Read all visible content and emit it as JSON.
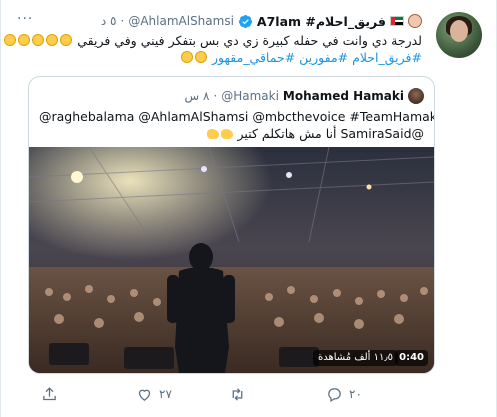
{
  "tweet": {
    "display_name": "A7lam #فريق_احلام",
    "handle": "@AhlamAlShamsi",
    "dot": "·",
    "time": "٥ د",
    "text_lines": [
      "لدرجة دي وانت في حفله كبيرة زي دي بس بتفكر فيني وفي فريقي",
      "#فريق_احلام #مفورين #حماقي_مقهور"
    ]
  },
  "quoted": {
    "name": "Mohamed Hamaki",
    "handle": "@Hamaki",
    "dot": "·",
    "time": "٨ س",
    "text_lines": [
      "@raghebalama @AhlamAlShamsi @mbcthevoice #TeamHamaki",
      "@SamiraSaid أنا مش هاتكلم كتير"
    ],
    "video": {
      "views": "١١٫٥ ألف مُشاهدة",
      "duration": "0:40"
    }
  },
  "actions": {
    "reply_count": "٢٠",
    "retweet_count": "",
    "like_count": "٢٧",
    "share_count": ""
  },
  "colors": {
    "accent": "#1b95e0",
    "muted": "#5b7083",
    "verified": "#1da1f2"
  },
  "icons": [
    "more-icon",
    "verified-icon",
    "uae-flag-icon",
    "reply-icon",
    "retweet-icon",
    "like-icon",
    "share-icon"
  ]
}
